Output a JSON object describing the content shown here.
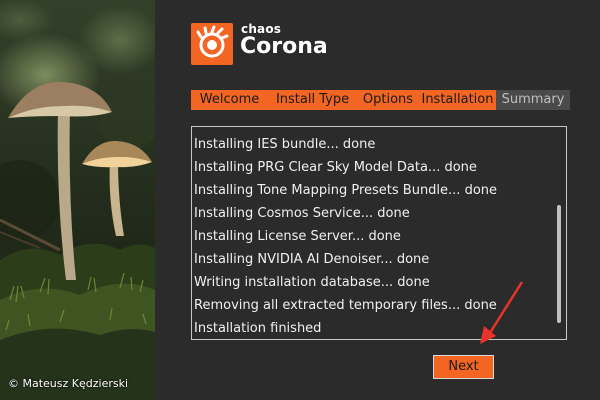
{
  "credit": "© Mateusz Kędzierski",
  "brand": {
    "small": "chaos",
    "name": "Corona",
    "accent": "#f26522"
  },
  "tabs": [
    {
      "label": "Welcome",
      "active": true
    },
    {
      "label": "Install Type",
      "active": true
    },
    {
      "label": "Options",
      "active": true
    },
    {
      "label": "Installation",
      "active": true
    },
    {
      "label": "Summary",
      "active": false
    }
  ],
  "log": {
    "lines": [
      "Installing IES bundle... done",
      "Installing PRG Clear Sky Model Data... done",
      "Installing Tone Mapping Presets Bundle... done",
      "Installing Cosmos Service... done",
      "Installing License Server... done",
      "Installing NVIDIA AI Denoiser... done",
      "Writing installation database... done",
      "Removing all extracted temporary files... done",
      "Installation finished"
    ]
  },
  "buttons": {
    "next": "Next"
  },
  "annotation": {
    "arrow_color": "#e8332a"
  }
}
